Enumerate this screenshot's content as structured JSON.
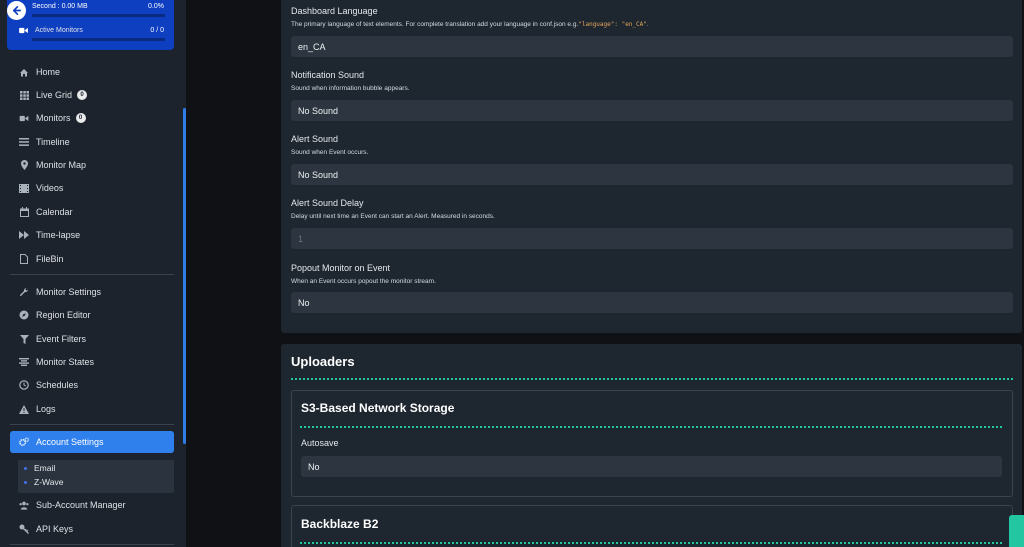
{
  "stats": {
    "second_label": "Second : 0.00 MB",
    "second_pct": "0.0%",
    "second_fill": 0,
    "monitors_label": "Active Monitors",
    "monitors_val": "0 / 0",
    "monitors_fill": 0
  },
  "sidebar": {
    "items": [
      {
        "label": "Home",
        "icon": "home-icon"
      },
      {
        "label": "Live Grid",
        "icon": "grid-icon",
        "badge": "0"
      },
      {
        "label": "Monitors",
        "icon": "video-camera-icon",
        "badge": "0"
      },
      {
        "label": "Timeline",
        "icon": "timeline-icon"
      },
      {
        "label": "Monitor Map",
        "icon": "map-marker-icon"
      },
      {
        "label": "Videos",
        "icon": "film-icon"
      },
      {
        "label": "Calendar",
        "icon": "calendar-icon"
      },
      {
        "label": "Time-lapse",
        "icon": "fast-forward-icon"
      },
      {
        "label": "FileBin",
        "icon": "file-icon"
      },
      {
        "label": "Monitor Settings",
        "icon": "wrench-icon"
      },
      {
        "label": "Region Editor",
        "icon": "compass-icon"
      },
      {
        "label": "Event Filters",
        "icon": "filter-icon"
      },
      {
        "label": "Monitor States",
        "icon": "align-icon"
      },
      {
        "label": "Schedules",
        "icon": "clock-icon"
      },
      {
        "label": "Logs",
        "icon": "warning-icon"
      },
      {
        "label": "Account Settings",
        "icon": "gears-icon"
      },
      {
        "label": "Sub-Account Manager",
        "icon": "users-icon"
      },
      {
        "label": "API Keys",
        "icon": "key-icon"
      }
    ],
    "submenu": [
      "Email",
      "Z-Wave"
    ]
  },
  "settings": {
    "language": {
      "label": "Dashboard Language",
      "help": "The primary language of text elements. For complete translation add your language in conf.json e.g.",
      "code": "\"language\": \"en_CA\"",
      "help_end": ".",
      "value": "en_CA"
    },
    "notification_sound": {
      "label": "Notification Sound",
      "help": "Sound when information bubble appears.",
      "value": "No Sound"
    },
    "alert_sound": {
      "label": "Alert Sound",
      "help": "Sound when Event occurs.",
      "value": "No Sound"
    },
    "alert_delay": {
      "label": "Alert Sound Delay",
      "help": "Delay until next time an Event can start an Alert. Measured in seconds.",
      "placeholder": "1"
    },
    "popout": {
      "label": "Popout Monitor on Event",
      "help": "When an Event occurs popout the monitor stream.",
      "value": "No"
    }
  },
  "uploaders": {
    "title": "Uploaders",
    "s3": {
      "title": "S3-Based Network Storage",
      "autosave_label": "Autosave",
      "autosave_value": "No"
    },
    "b2": {
      "title": "Backblaze B2"
    }
  },
  "colors": {
    "accent": "#2f80ed",
    "stats_bg": "#0e3fc1",
    "divider_teal": "#22c7a2"
  }
}
